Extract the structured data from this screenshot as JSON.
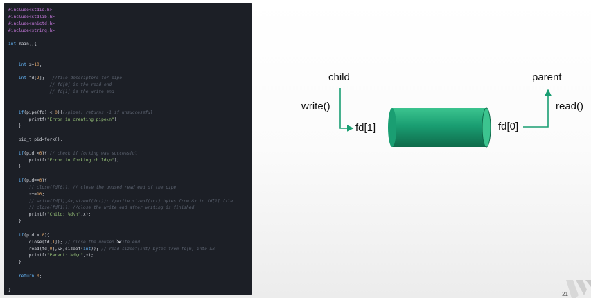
{
  "code": [
    [
      {
        "t": "#include<stdio.h>",
        "c": "c-dir"
      }
    ],
    [
      {
        "t": "#include<stdlib.h>",
        "c": "c-dir"
      }
    ],
    [
      {
        "t": "#include<unistd.h>",
        "c": "c-dir"
      }
    ],
    [
      {
        "t": "#include<string.h>",
        "c": "c-dir"
      }
    ],
    [],
    [
      {
        "t": "int",
        "c": "c-kw"
      },
      {
        "t": " main(){"
      }
    ],
    [],
    [],
    [
      {
        "t": "    "
      },
      {
        "t": "int",
        "c": "c-kw"
      },
      {
        "t": " x="
      },
      {
        "t": "10",
        "c": "c-num"
      },
      {
        "t": ";"
      }
    ],
    [],
    [
      {
        "t": "    "
      },
      {
        "t": "int",
        "c": "c-kw"
      },
      {
        "t": " fd["
      },
      {
        "t": "2",
        "c": "c-num"
      },
      {
        "t": "];   "
      },
      {
        "t": "//file descriptors for pipe",
        "c": "c-cm"
      }
    ],
    [
      {
        "t": "                "
      },
      {
        "t": "// fd[0] is the read end",
        "c": "c-cm"
      }
    ],
    [
      {
        "t": "                "
      },
      {
        "t": "// fd[1] is the write end",
        "c": "c-cm"
      }
    ],
    [],
    [],
    [
      {
        "t": "    "
      },
      {
        "t": "if",
        "c": "c-kw"
      },
      {
        "t": "(pipe(fd) < "
      },
      {
        "t": "0",
        "c": "c-num"
      },
      {
        "t": "){"
      },
      {
        "t": "//pipe() returns -1 if unsuccessful",
        "c": "c-cm"
      }
    ],
    [
      {
        "t": "        printf("
      },
      {
        "t": "\"Error in creating pipe\\n\"",
        "c": "c-str"
      },
      {
        "t": ");"
      }
    ],
    [
      {
        "t": "    }"
      }
    ],
    [],
    [
      {
        "t": "    pid_t pid=fork();"
      }
    ],
    [],
    [
      {
        "t": "    "
      },
      {
        "t": "if",
        "c": "c-kw"
      },
      {
        "t": "(pid <"
      },
      {
        "t": "0",
        "c": "c-num"
      },
      {
        "t": "){ "
      },
      {
        "t": "// check if forking was successful",
        "c": "c-cm"
      }
    ],
    [
      {
        "t": "        printf("
      },
      {
        "t": "\"Error in forking child\\n\"",
        "c": "c-str"
      },
      {
        "t": ");"
      }
    ],
    [
      {
        "t": "    }"
      }
    ],
    [],
    [
      {
        "t": "    "
      },
      {
        "t": "if",
        "c": "c-kw"
      },
      {
        "t": "(pid=="
      },
      {
        "t": "0",
        "c": "c-num"
      },
      {
        "t": "){"
      }
    ],
    [
      {
        "t": "        "
      },
      {
        "t": "// close(fd[0]); // close the unused read end of the pipe",
        "c": "c-cm"
      }
    ],
    [
      {
        "t": "        x+="
      },
      {
        "t": "10",
        "c": "c-num"
      },
      {
        "t": ";"
      }
    ],
    [
      {
        "t": "        "
      },
      {
        "t": "// write(fd[1],&x,sizeof(int)); //write sizeof(int) bytes from &x to fd[1] file",
        "c": "c-cm"
      }
    ],
    [
      {
        "t": "        "
      },
      {
        "t": "// close(fd[1]); //close the write end after writing is finished",
        "c": "c-cm"
      }
    ],
    [
      {
        "t": "        printf("
      },
      {
        "t": "\"Child: %d\\n\"",
        "c": "c-str"
      },
      {
        "t": ",x);"
      }
    ],
    [
      {
        "t": "    }"
      }
    ],
    [],
    [
      {
        "t": "    "
      },
      {
        "t": "if",
        "c": "c-kw"
      },
      {
        "t": "(pid > "
      },
      {
        "t": "0",
        "c": "c-num"
      },
      {
        "t": "){"
      }
    ],
    [
      {
        "t": "        close(fd["
      },
      {
        "t": "1",
        "c": "c-num"
      },
      {
        "t": "]); "
      },
      {
        "t": "// close the unused write end",
        "c": "c-cm"
      }
    ],
    [
      {
        "t": "        read(fd["
      },
      {
        "t": "0",
        "c": "c-num"
      },
      {
        "t": "],&x,sizeof("
      },
      {
        "t": "int",
        "c": "c-kw"
      },
      {
        "t": ")); "
      },
      {
        "t": "// read sizeof(int) bytes from fd[0] into &x",
        "c": "c-cm"
      }
    ],
    [
      {
        "t": "        printf("
      },
      {
        "t": "\"Parent: %d\\n\"",
        "c": "c-str"
      },
      {
        "t": ",x);"
      }
    ],
    [
      {
        "t": "    }"
      }
    ],
    [],
    [
      {
        "t": "    "
      },
      {
        "t": "return",
        "c": "c-kw"
      },
      {
        "t": " "
      },
      {
        "t": "0",
        "c": "c-num"
      },
      {
        "t": ";"
      }
    ],
    [],
    [
      {
        "t": "}"
      }
    ]
  ],
  "diagram": {
    "child": "child",
    "parent": "parent",
    "write": "write()",
    "read": "read()",
    "fd1": "fd[1]",
    "fd0": "fd[0]",
    "pipe_color": "#1a9e72",
    "pipe_dark": "#0f6b4b",
    "pipe_light": "#3cc48f"
  },
  "page_number": "21"
}
